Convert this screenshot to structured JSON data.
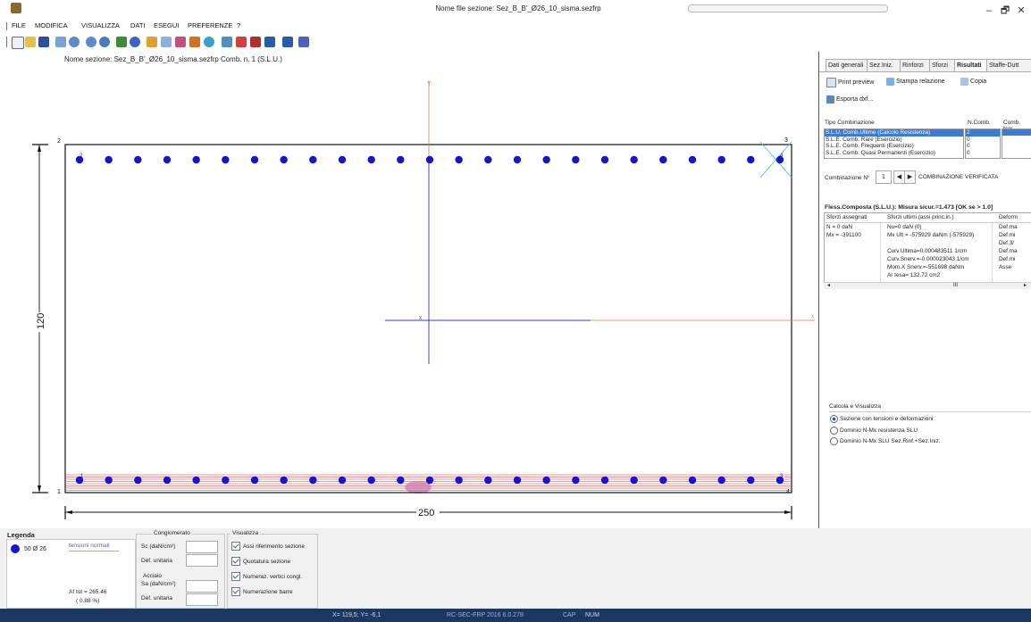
{
  "window": {
    "title": "Nome file sezione: Sez_B_B'_Ø26_10_sisma.sezfrp",
    "controls": {
      "minimize": "–",
      "restore": "🗗",
      "close": "✕"
    }
  },
  "menu": [
    "FILE",
    "MODIFICA",
    "VISUALIZZA",
    "DATI",
    "ESEGUI",
    "PREFERENZE",
    "?"
  ],
  "toolbar_icons": [
    "new-file-icon",
    "open-folder-icon",
    "save-icon",
    "copy-icon",
    "zoom-in-icon",
    "zoom-out-icon",
    "zoom-window-icon",
    "pan-icon",
    "redraw-icon",
    "diagram-icon",
    "chart-icon",
    "table-icon",
    "section-icon",
    "rebar-icon",
    "calc-icon",
    "domain-icon",
    "print-icon",
    "settings-icon",
    "export-icon",
    "help-icon"
  ],
  "canvas": {
    "header": "Nome sezione: Sez_B_B'_Ø26_10_sisma.sezfrp    Comb. n. 1 (S.L.U.)",
    "dim_height": "120",
    "dim_width": "250",
    "vertex_labels": [
      "1",
      "2",
      "3",
      "4"
    ],
    "axis_y_label": "Y",
    "axis_x_label": "x",
    "axis_local_label": "X",
    "bar_labels": [
      "2",
      "4",
      "1",
      "3"
    ],
    "top_bar_count": 25,
    "bottom_bar_count": 25
  },
  "right_panel": {
    "tabs": [
      "Dati generali",
      "Sez.Iniz.",
      "Rinforzi",
      "Sforzi",
      "Risultati",
      "Staffe-Dutt"
    ],
    "active_tab": "Risultati",
    "print_preview": "Print preview",
    "stampa": "Stampa relazione",
    "copia": "Copia",
    "esporta": "Esporta dxf...",
    "tipo_combinazione_header": "Tipo Combinazione",
    "ncomb_header": "N.Comb.",
    "comb_nom_header": "Comb. Nor",
    "combinations": [
      {
        "label": "S.L.U. Comb.Ultime (Calcolo Resistenza)",
        "n": "2"
      },
      {
        "label": "S.L.E. Comb. Rare (Esercizio)",
        "n": "0"
      },
      {
        "label": "S.L.E. Comb. Frequenti (Esercizio)",
        "n": "0"
      },
      {
        "label": "S.L.E. Comb. Quasi Permanenti (Esercizio)",
        "n": "0"
      }
    ],
    "combinazione_label": "Combinazione N°",
    "combinazione_value": "1",
    "verifica_text": "COMBINAZIONE VERIFICATA",
    "result_title": "Fless.Composta (S.L.U.): Misura sicur.=1.473 [OK se > 1.0]",
    "table_headers": [
      "Sforzi assegnati",
      "Sforzi ultimi (assi princ.in.)",
      "Deform"
    ],
    "table_rows": [
      [
        "N  = 0 daN",
        "Nu=0 daN (0)",
        "Def.ma"
      ],
      [
        "Mx  = -391100",
        "Mx Ult = -575929 daNm (-575929)",
        "Def.mi"
      ],
      [
        "",
        "",
        "Def.3/"
      ],
      [
        "",
        "Curv.Ultima=0.000483511 1/cm",
        "Def.ma"
      ],
      [
        "",
        "Curv.Snerv.=-0.000023043 1/cm",
        "Def.mi"
      ],
      [
        "",
        "Mom.X Snerv.=-551698 daNm",
        "Asse"
      ],
      [
        "",
        "Ar tesa= 132.72 cm2",
        ""
      ]
    ],
    "scroll_mid": "III",
    "calcola_title": "Calcola e Visualizza",
    "radio_options": [
      "Sezione con tensioni e deformazioni",
      "Dominio N-Mx resistenza SLU",
      "Dominio N-Mx SLU Sez.Rinf.+Sez.Iniz."
    ]
  },
  "legend": {
    "title": "Legenda",
    "bar_spec": "50 Ø 26",
    "tension_label": "tensioni normali",
    "af_tot": "Af tot = 265.46",
    "af_pct": "( 0.88 %)"
  },
  "conglomerato": {
    "title": "Conglomerato",
    "sc": "Sc (daN/cm²)",
    "def": "Def. unitaria"
  },
  "acciaio": {
    "title": "Acciaio",
    "sa": "Sa (daN/cm²)",
    "def": "Def. unitaria"
  },
  "visualizza": {
    "title": "Visualizza",
    "options": [
      "Assi riferimento sezione",
      "Quotatura sezione",
      "Numeraz. vertici congl.",
      "Numerazione barre"
    ]
  },
  "status": {
    "coords": "X= 119,5; Y= -6,1",
    "program": "RC-SEC-FRP 2016 6.0.278",
    "caps": "CAP",
    "num": "NUM"
  },
  "colors": {
    "bar": "#1414d2",
    "axis_y": "#e8793a",
    "axis_blue": "#2b3ad8",
    "stress": "#e03030",
    "status_bg": "#1d3763"
  }
}
